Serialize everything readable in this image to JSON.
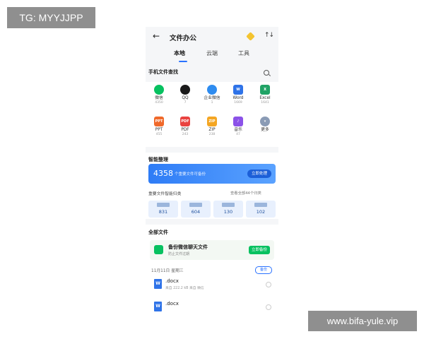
{
  "watermarks": {
    "top_left": "TG: MYYJJPP",
    "bottom_right": "www.bifa-yule.vip"
  },
  "header": {
    "title": "文件办公",
    "back_icon": "arrow-left-icon",
    "vip_icon": "diamond-icon",
    "sort_icon": "sort-icon"
  },
  "tabs": [
    "本地",
    "云端",
    "工具"
  ],
  "phone_search": {
    "title": "手机文件查找"
  },
  "apps": [
    {
      "name": "微信",
      "count": "4350",
      "color": "#07c160",
      "icon": "wechat-icon"
    },
    {
      "name": "QQ",
      "count": "7",
      "color": "#1a1a1a",
      "icon": "qq-icon"
    },
    {
      "name": "企业微信",
      "count": "1",
      "color": "#2e8cf0",
      "icon": "wecom-icon"
    },
    {
      "name": "Word",
      "count": "1669",
      "color": "#2f73e8",
      "icon": "word-icon",
      "glyph": "W"
    },
    {
      "name": "Excel",
      "count": "1641",
      "color": "#21a366",
      "icon": "excel-icon",
      "glyph": "X"
    },
    {
      "name": "PPT",
      "count": "455",
      "color": "#f0692a",
      "icon": "ppt-icon",
      "glyph": "PPT"
    },
    {
      "name": "PDF",
      "count": "243",
      "color": "#e94340",
      "icon": "pdf-icon",
      "glyph": "PDF"
    },
    {
      "name": "ZIP",
      "count": "238",
      "color": "#f4a623",
      "icon": "zip-icon",
      "glyph": "ZIP"
    },
    {
      "name": "音乐",
      "count": "47",
      "color": "#8b52e8",
      "icon": "music-icon",
      "glyph": "♪"
    },
    {
      "name": "更多",
      "count": "",
      "color": "#8a9bb5",
      "icon": "more-icon",
      "glyph": "▾"
    }
  ],
  "smart": {
    "title": "智能整理",
    "count": "4358",
    "desc": "个重要文件可备份",
    "button": "立即处理",
    "category_title": "重要文件智能归类",
    "category_link": "查看全部44个归类",
    "categories": [
      "831",
      "604",
      "130",
      "102"
    ]
  },
  "all_files": {
    "title": "全部文件",
    "backup_title": "备份微信聊天文件",
    "backup_sub": "防止文件过期",
    "backup_button": "立即备份",
    "date": "11月11日 星期三",
    "date_badge": "备份",
    "files": [
      {
        "name": ".docx",
        "meta": "来自    222.2 kB  来自 微信"
      },
      {
        "name": ".docx",
        "meta": ""
      }
    ]
  }
}
